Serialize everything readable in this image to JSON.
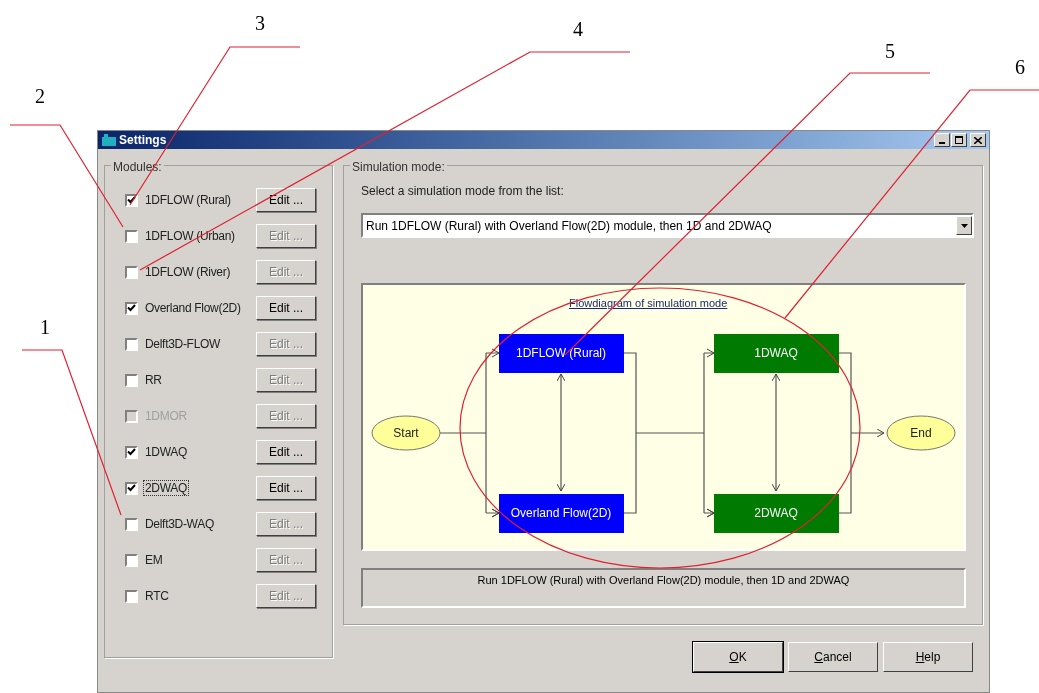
{
  "window": {
    "title": "Settings"
  },
  "modules": {
    "title": "Modules:",
    "items": [
      {
        "label": "1DFLOW (Rural)",
        "checked": true,
        "disabled": false,
        "focused": false,
        "edit": {
          "label": "Edit ...",
          "disabled": false
        }
      },
      {
        "label": "1DFLOW (Urban)",
        "checked": false,
        "disabled": false,
        "focused": false,
        "edit": {
          "label": "Edit ...",
          "disabled": true
        }
      },
      {
        "label": "1DFLOW (River)",
        "checked": false,
        "disabled": false,
        "focused": false,
        "edit": {
          "label": "Edit ...",
          "disabled": true
        }
      },
      {
        "label": "Overland Flow(2D)",
        "checked": true,
        "disabled": false,
        "focused": false,
        "edit": {
          "label": "Edit ...",
          "disabled": false
        }
      },
      {
        "label": "Delft3D-FLOW",
        "checked": false,
        "disabled": false,
        "focused": false,
        "edit": {
          "label": "Edit ...",
          "disabled": true
        }
      },
      {
        "label": "RR",
        "checked": false,
        "disabled": false,
        "focused": false,
        "edit": {
          "label": "Edit ...",
          "disabled": true
        }
      },
      {
        "label": "1DMOR",
        "checked": false,
        "disabled": true,
        "focused": false,
        "edit": {
          "label": "Edit ...",
          "disabled": true
        }
      },
      {
        "label": "1DWAQ",
        "checked": true,
        "disabled": false,
        "focused": false,
        "edit": {
          "label": "Edit ...",
          "disabled": false
        }
      },
      {
        "label": "2DWAQ",
        "checked": true,
        "disabled": false,
        "focused": true,
        "edit": {
          "label": "Edit ...",
          "disabled": false
        }
      },
      {
        "label": "Delft3D-WAQ",
        "checked": false,
        "disabled": false,
        "focused": false,
        "edit": {
          "label": "Edit ...",
          "disabled": true
        }
      },
      {
        "label": "EM",
        "checked": false,
        "disabled": false,
        "focused": false,
        "edit": {
          "label": "Edit ...",
          "disabled": true
        }
      },
      {
        "label": "RTC",
        "checked": false,
        "disabled": false,
        "focused": false,
        "edit": {
          "label": "Edit ...",
          "disabled": true
        }
      }
    ]
  },
  "simulation": {
    "title": "Simulation mode:",
    "prompt": "Select a simulation mode from the list:",
    "mode": "Run 1DFLOW (Rural) with Overland Flow(2D) module, then 1D and 2DWAQ",
    "diagram": {
      "link": "Flowdiagram of simulation mode",
      "nodes": [
        {
          "kind": "terminal",
          "label": "Start"
        },
        {
          "kind": "box",
          "label": "1DFLOW (Rural)",
          "color": "#0000ff"
        },
        {
          "kind": "box",
          "label": "Overland Flow(2D)",
          "color": "#0000ff"
        },
        {
          "kind": "box",
          "label": "1DWAQ",
          "color": "#007a00"
        },
        {
          "kind": "box",
          "label": "2DWAQ",
          "color": "#007a00"
        },
        {
          "kind": "terminal",
          "label": "End"
        }
      ]
    },
    "description": "Run 1DFLOW (Rural) with Overland Flow(2D) module, then 1D and 2DWAQ"
  },
  "buttons": [
    {
      "label": "OK"
    },
    {
      "label": "Cancel"
    },
    {
      "label": "Help"
    }
  ],
  "callouts": [
    {
      "label": "1"
    },
    {
      "label": "2"
    },
    {
      "label": "3"
    },
    {
      "label": "4"
    },
    {
      "label": "5"
    },
    {
      "label": "6"
    }
  ]
}
